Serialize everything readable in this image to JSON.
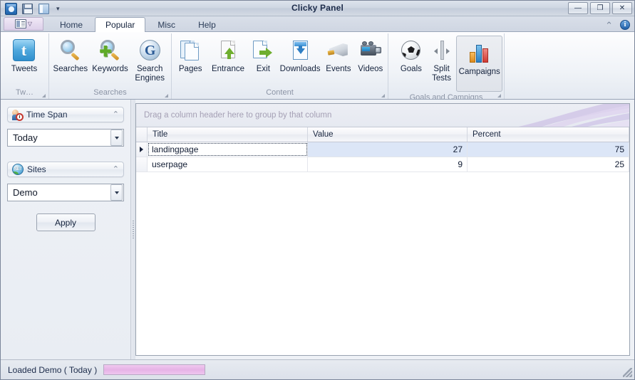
{
  "window": {
    "title": "Clicky Panel",
    "quick_access": [
      {
        "name": "app-icon",
        "icon": "app-icon"
      },
      {
        "name": "save",
        "icon": "save-icon"
      },
      {
        "name": "panel",
        "icon": "panel-icon"
      },
      {
        "name": "customize",
        "icon": "chevron-down-icon",
        "glyph": "▾"
      }
    ],
    "controls": {
      "minimize": "—",
      "maximize": "❐",
      "close": "✕"
    }
  },
  "tabs": {
    "app_menu_caret": "▽",
    "items": [
      {
        "label": "Home",
        "active": false
      },
      {
        "label": "Popular",
        "active": true
      },
      {
        "label": "Misc",
        "active": false
      },
      {
        "label": "Help",
        "active": false
      }
    ],
    "collapse_glyph": "⌃",
    "info_glyph": "i"
  },
  "ribbon": {
    "groups": [
      {
        "label": "Tw…",
        "has_dialog_launcher": true,
        "buttons": [
          {
            "label": "Tweets",
            "icon": "twitter-icon",
            "selected": false
          }
        ]
      },
      {
        "label": "Searches",
        "has_dialog_launcher": true,
        "buttons": [
          {
            "label": "Searches",
            "icon": "magnifier-icon",
            "selected": false
          },
          {
            "label": "Keywords",
            "icon": "magnifier-plus-icon",
            "selected": false
          },
          {
            "label": "Search Engines",
            "icon": "google-icon",
            "selected": false
          }
        ]
      },
      {
        "label": "Content",
        "has_dialog_launcher": true,
        "buttons": [
          {
            "label": "Pages",
            "icon": "pages-icon",
            "selected": false
          },
          {
            "label": "Entrance",
            "icon": "entrance-arrow-icon",
            "selected": false
          },
          {
            "label": "Exit",
            "icon": "exit-arrow-icon",
            "selected": false
          },
          {
            "label": "Downloads",
            "icon": "download-icon",
            "selected": false
          },
          {
            "label": "Events",
            "icon": "megaphone-icon",
            "selected": false
          },
          {
            "label": "Videos",
            "icon": "camcorder-icon",
            "selected": false
          }
        ]
      },
      {
        "label": "Goals and Campigns",
        "has_dialog_launcher": true,
        "buttons": [
          {
            "label": "Goals",
            "icon": "soccer-ball-icon",
            "selected": false
          },
          {
            "label": "Split Tests",
            "icon": "split-test-icon",
            "selected": false
          },
          {
            "label": "Campaigns",
            "icon": "bar-chart-icon",
            "selected": true
          }
        ]
      }
    ]
  },
  "sidebar": {
    "sections": [
      {
        "title": "Time Span",
        "icon": "time-span-icon",
        "chevron": "⌃",
        "combo": {
          "value": "Today",
          "placeholder": "Today"
        }
      },
      {
        "title": "Sites",
        "icon": "sites-globe-icon",
        "chevron": "⌃",
        "combo": {
          "value": "Demo",
          "placeholder": "Demo"
        }
      }
    ],
    "apply_label": "Apply"
  },
  "grid": {
    "group_hint": "Drag a column header here to group by that column",
    "columns": [
      "Title",
      "Value",
      "Percent"
    ],
    "rows": [
      {
        "title": "landingpage",
        "value": "27",
        "percent": "75",
        "selected": true
      },
      {
        "title": "userpage",
        "value": "9",
        "percent": "25",
        "selected": false
      }
    ]
  },
  "status": {
    "text": "Loaded Demo ( Today )",
    "progress_color": "#e6b2e6"
  }
}
